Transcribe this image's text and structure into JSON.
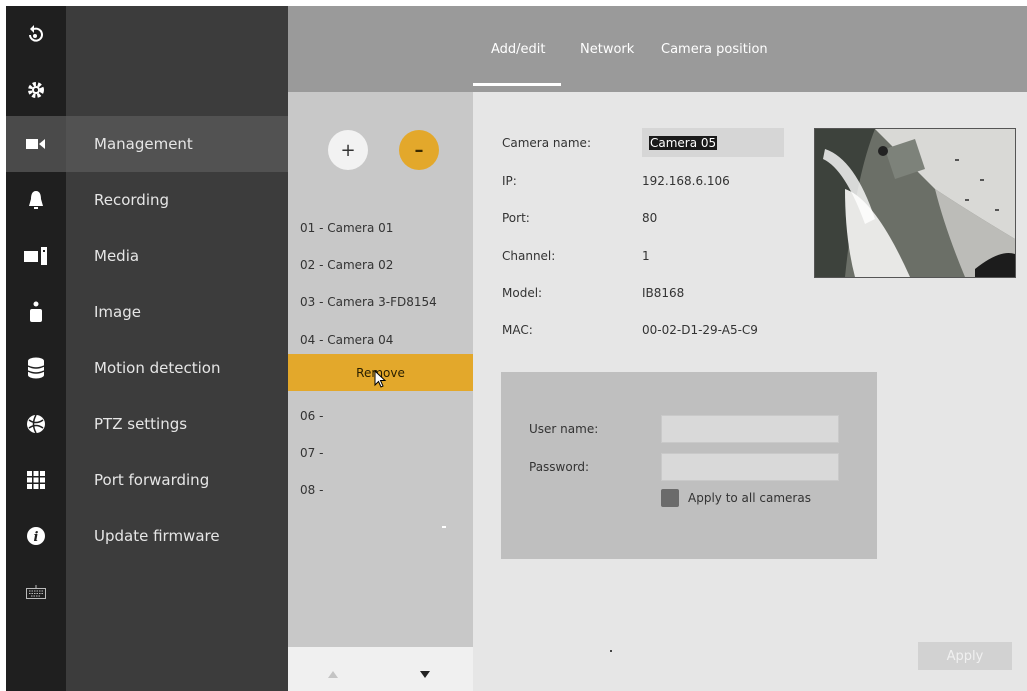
{
  "tabs": [
    {
      "label": "Add/edit",
      "active": true
    },
    {
      "label": "Network"
    },
    {
      "label": "Camera position"
    }
  ],
  "rail_icons": [
    "back-icon",
    "gear-icon",
    "camera-icon",
    "bell-icon",
    "monitor-icon",
    "person-icon",
    "database-icon",
    "globe-icon",
    "grid-icon",
    "info-icon",
    "keyboard-icon"
  ],
  "menu": {
    "items": [
      {
        "label": "Management",
        "active": true
      },
      {
        "label": "Recording"
      },
      {
        "label": "Media"
      },
      {
        "label": "Image"
      },
      {
        "label": "Motion detection"
      },
      {
        "label": "PTZ settings"
      },
      {
        "label": "Port forwarding"
      },
      {
        "label": "Update firmware"
      }
    ]
  },
  "list": {
    "add_label": "+",
    "remove_label": "–",
    "items": [
      "01 - Camera 01",
      "02 - Camera 02",
      "03 - Camera 3-FD8154",
      "04 - Camera 04",
      "06 -",
      "07 -",
      "08 -"
    ],
    "context_action": "Remove"
  },
  "camera": {
    "name_label": "Camera name:",
    "name_value": "Camera 05",
    "ip_label": "IP:",
    "ip_value": "192.168.6.106",
    "port_label": "Port:",
    "port_value": "80",
    "channel_label": "Channel:",
    "channel_value": "1",
    "model_label": "Model:",
    "model_value": "IB8168",
    "mac_label": "MAC:",
    "mac_value": "00-02-D1-29-A5-C9"
  },
  "credentials": {
    "username_label": "User name:",
    "username_value": "",
    "password_label": "Password:",
    "password_value": "",
    "apply_all_label": "Apply to all cameras"
  },
  "apply_label": "Apply",
  "colors": {
    "accent": "#e3a82b",
    "rail": "#1f1f1f",
    "menu": "#3c3c3c",
    "topbar": "#9a9a9a"
  }
}
